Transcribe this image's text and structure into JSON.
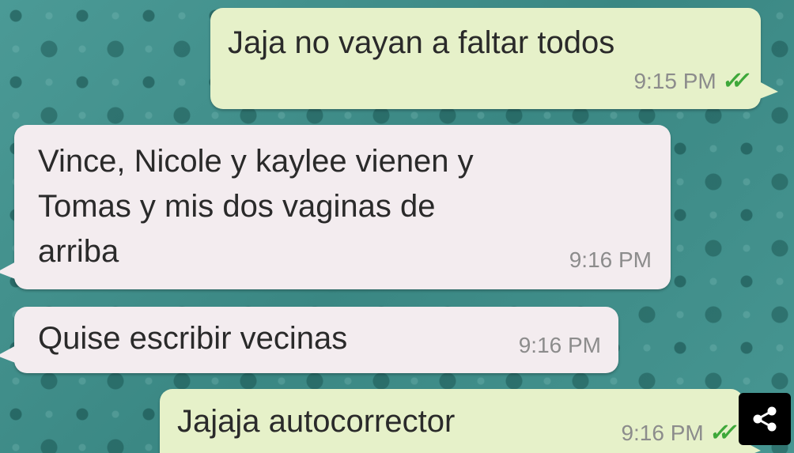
{
  "messages": [
    {
      "direction": "outgoing",
      "text": "Jaja no vayan a faltar todos",
      "time": "9:15 PM",
      "status_icon": "double-check-icon"
    },
    {
      "direction": "incoming",
      "text": "Vince,  Nicole y kaylee vienen y\nTomas y mis dos vaginas de\narriba",
      "time": "9:16 PM"
    },
    {
      "direction": "incoming",
      "text": "Quise escribir vecinas",
      "time": "9:16 PM"
    },
    {
      "direction": "outgoing",
      "text": "Jajaja autocorrector",
      "time": "9:16 PM",
      "status_icon": "double-check-icon"
    }
  ],
  "ticks_glyph": "✓✓",
  "share": {
    "icon": "share-icon"
  },
  "colors": {
    "wallpaper": "#3f8f8c",
    "outgoing_bubble": "#e6f1c9",
    "incoming_bubble": "#f3ecef",
    "read_ticks": "#3ea83a",
    "timestamp": "#8c8c8c"
  }
}
